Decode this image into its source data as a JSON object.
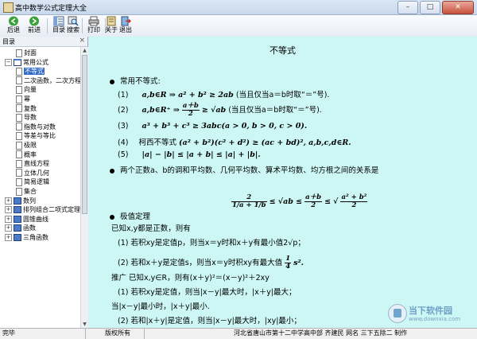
{
  "window": {
    "title": "高中数学公式定理大全",
    "min": "–",
    "max": "□",
    "close": "✕"
  },
  "toolbar": {
    "items": [
      {
        "label": "后退",
        "icon": "back-arrow-icon"
      },
      {
        "label": "前进",
        "icon": "forward-arrow-icon"
      },
      {
        "label": "目录",
        "icon": "contents-icon"
      },
      {
        "label": "搜索",
        "icon": "search-icon"
      },
      {
        "label": "打印",
        "icon": "print-icon"
      },
      {
        "label": "关于",
        "icon": "about-icon"
      },
      {
        "label": "退出",
        "icon": "exit-icon"
      }
    ]
  },
  "sidebar": {
    "header": "目录",
    "close": "×",
    "tree": [
      {
        "label": "封面",
        "level": 1,
        "type": "page"
      },
      {
        "label": "常用公式",
        "level": 0,
        "type": "bookopen",
        "expander": "−"
      },
      {
        "label": "不等式",
        "level": 1,
        "type": "page",
        "selected": true
      },
      {
        "label": "二次函数，二次方程",
        "level": 1,
        "type": "page"
      },
      {
        "label": "向量",
        "level": 1,
        "type": "page"
      },
      {
        "label": "幂",
        "level": 1,
        "type": "page"
      },
      {
        "label": "复数",
        "level": 1,
        "type": "page"
      },
      {
        "label": "导数",
        "level": 1,
        "type": "page"
      },
      {
        "label": "指数与对数",
        "level": 1,
        "type": "page"
      },
      {
        "label": "等差与等比",
        "level": 1,
        "type": "page"
      },
      {
        "label": "极限",
        "level": 1,
        "type": "page"
      },
      {
        "label": "概率",
        "level": 1,
        "type": "page"
      },
      {
        "label": "直线方程",
        "level": 1,
        "type": "page"
      },
      {
        "label": "立体几何",
        "level": 1,
        "type": "page"
      },
      {
        "label": "简易逻辑",
        "level": 1,
        "type": "page"
      },
      {
        "label": "集合",
        "level": 1,
        "type": "page"
      },
      {
        "label": "数列",
        "level": 0,
        "type": "book",
        "expander": "+"
      },
      {
        "label": "排列组合二项式定理",
        "level": 0,
        "type": "book",
        "expander": "+"
      },
      {
        "label": "圆锥曲线",
        "level": 0,
        "type": "book",
        "expander": "+"
      },
      {
        "label": "函数",
        "level": 0,
        "type": "book",
        "expander": "+"
      },
      {
        "label": "三角函数",
        "level": 0,
        "type": "book",
        "expander": "+"
      }
    ]
  },
  "content": {
    "heading": "不等式",
    "bg": "#ccf7f4",
    "s1_title": "常用不等式:",
    "l1_a": "(1)",
    "l1_m": "a,b∈R ⇒ a² + b² ≥ 2ab",
    "l1_c": "(当且仅当a＝b时取“＝”号).",
    "l2_a": "(2)",
    "l2_m1": "a,b∈R⁺ ⇒",
    "l2_fn": "a＋b",
    "l2_fd": "2",
    "l2_m2": "≥ √ab",
    "l2_c": "(当且仅当a＝b时取“＝”号).",
    "l3_a": "(3)",
    "l3_m": "a³ + b³ + c³ ≥ 3abc(a > 0, b > 0, c > 0).",
    "l4_a": "(4)",
    "l4_t": "柯西不等式",
    "l4_m": "(a² + b²)(c² + d²) ≥ (ac + bd)², a,b,c,d∈R.",
    "l5_a": "(5)",
    "l5_m": "|a| − |b| ≤ |a + b| ≤ |a| + |b|.",
    "s2": "两个正数a、b的调和平均数、几何平均数、算术平均数、均方根之间的关系是",
    "hm_n": "2",
    "hm_d": "1/a + 1/b",
    "hm_le1": "≤ √ab ≤",
    "am_n": "a＋b",
    "am_d": "2",
    "hm_le2": "≤",
    "rms_n": "a² + b²",
    "rms_d": "2",
    "s3_title": "极值定理",
    "s3_l1": "已知x,y都是正数，则有",
    "s3_l2_a": "(1) 若积xy是定值p，则当x＝y时和x＋y有最小值2√p；",
    "s3_l3_a": "(2) 若和x＋y是定值s，则当x＝y时积xy有最大值",
    "s3_l3_fn": "1",
    "s3_l3_fd": "4",
    "s3_l3_b": "s².",
    "s3_l4": "推广  已知x,y∈R，则有(x＋y)²＝(x－y)²＋2xy",
    "s3_l5": "(1) 若积xy是定值，则当|x－y|最大时，|x＋y|最大；",
    "s3_l6": "当|x－y|最小时，|x＋y|最小.",
    "s3_l7": "(2) 若和|x＋y|是定值，则当|x－y|最大时，|xy|最小；"
  },
  "status": {
    "c1": "完毕",
    "c2": "版权所有",
    "c3": "河北省唐山市第十二中学高中部  齐建民  网名 三下五除二  制作"
  },
  "watermark": {
    "name": "当下软件园",
    "url": "www.downxia.com"
  }
}
